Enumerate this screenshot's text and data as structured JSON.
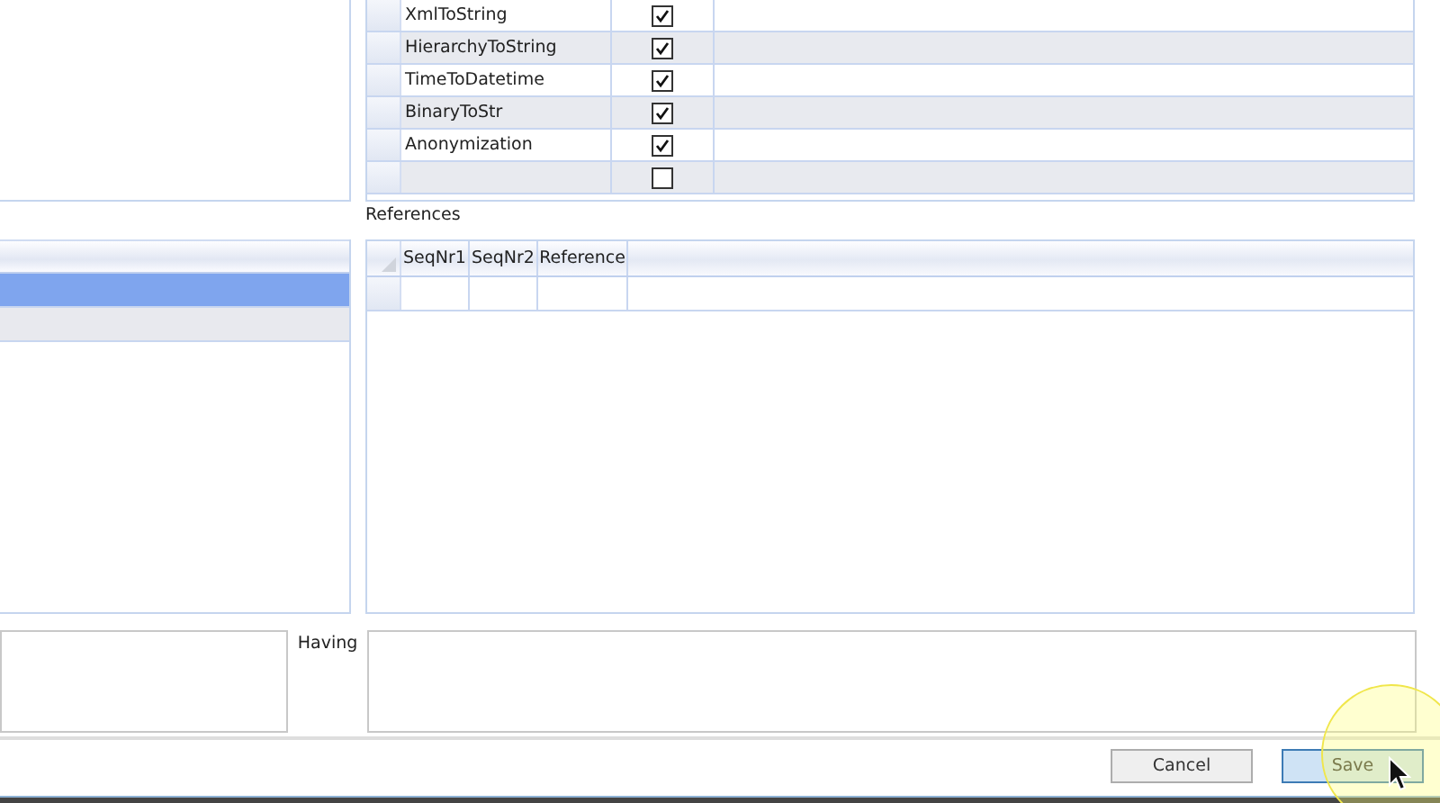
{
  "top_grid": {
    "rows": [
      {
        "name": "XmlToString",
        "checked": true
      },
      {
        "name": "HierarchyToString",
        "checked": true
      },
      {
        "name": "TimeToDatetime",
        "checked": true
      },
      {
        "name": "BinaryToStr",
        "checked": true
      },
      {
        "name": "Anonymization",
        "checked": true
      },
      {
        "checked": false
      }
    ]
  },
  "left_list": {
    "rows": [
      {
        "selected": true
      },
      {
        "selected": false
      }
    ]
  },
  "references": {
    "label": "References",
    "columns": [
      "SeqNr1",
      "SeqNr2",
      "Reference"
    ]
  },
  "having": {
    "label": "Having"
  },
  "buttons": [
    {
      "label": "Cancel",
      "kind": "default"
    },
    {
      "label": "Save",
      "kind": "primary"
    }
  ]
}
